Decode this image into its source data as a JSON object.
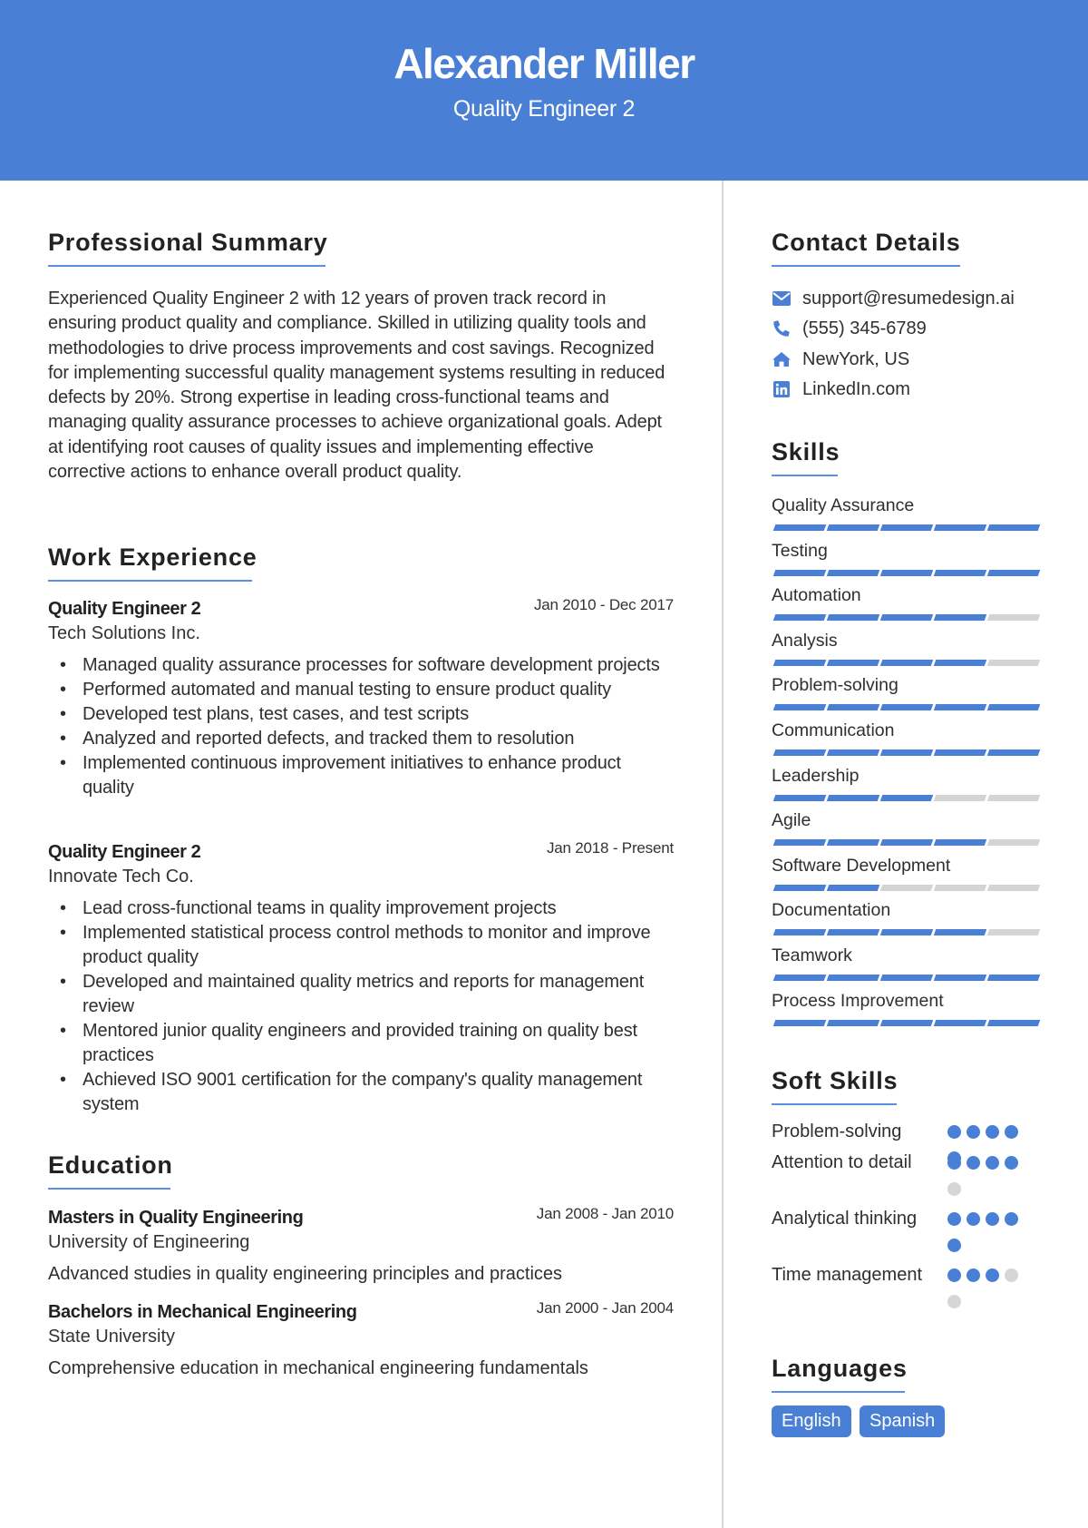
{
  "header": {
    "name": "Alexander Miller",
    "role": "Quality Engineer 2"
  },
  "colors": {
    "accent": "#4a7fd6",
    "track": "#d4d4d4",
    "divider": "#d6d6d6"
  },
  "summary": {
    "title": "Professional Summary",
    "text": "Experienced Quality Engineer 2 with 12 years of proven track record in ensuring product quality and compliance. Skilled in utilizing quality tools and methodologies to drive process improvements and cost savings. Recognized for implementing successful quality management systems resulting in reduced defects by 20%. Strong expertise in leading cross-functional teams and managing quality assurance processes to achieve organizational goals. Adept at identifying root causes of quality issues and implementing effective corrective actions to enhance overall product quality."
  },
  "experience": {
    "title": "Work Experience",
    "jobs": [
      {
        "title": "Quality Engineer 2",
        "dates": "Jan 2010 - Dec 2017",
        "company": "Tech Solutions Inc.",
        "bullets": [
          "Managed quality assurance processes for software development projects",
          "Performed automated and manual testing to ensure product quality",
          "Developed test plans, test cases, and test scripts",
          "Analyzed and reported defects, and tracked them to resolution",
          "Implemented continuous improvement initiatives to enhance product quality"
        ]
      },
      {
        "title": "Quality Engineer 2",
        "dates": "Jan 2018 - Present",
        "company": "Innovate Tech Co.",
        "bullets": [
          "Lead cross-functional teams in quality improvement projects",
          "Implemented statistical process control methods to monitor and improve product quality",
          "Developed and maintained quality metrics and reports for management review",
          "Mentored junior quality engineers and provided training on quality best practices",
          "Achieved ISO 9001 certification for the company's quality management system"
        ]
      }
    ]
  },
  "education": {
    "title": "Education",
    "items": [
      {
        "degree": "Masters in Quality Engineering",
        "dates": "Jan 2008 - Jan 2010",
        "school": "University of Engineering",
        "description": "Advanced studies in quality engineering principles and practices"
      },
      {
        "degree": "Bachelors in Mechanical Engineering",
        "dates": "Jan 2000 - Jan 2004",
        "school": "State University",
        "description": "Comprehensive education in mechanical engineering fundamentals"
      }
    ]
  },
  "contact": {
    "title": "Contact Details",
    "items": [
      {
        "icon": "envelope-icon",
        "text": "support@resumedesign.ai"
      },
      {
        "icon": "phone-icon",
        "text": "(555) 345-6789"
      },
      {
        "icon": "home-icon",
        "text": "NewYork, US"
      },
      {
        "icon": "linkedin-icon",
        "text": "LinkedIn.com"
      }
    ]
  },
  "skills": {
    "title": "Skills",
    "max": 5,
    "items": [
      {
        "name": "Quality Assurance",
        "level": 5
      },
      {
        "name": "Testing",
        "level": 5
      },
      {
        "name": "Automation",
        "level": 4
      },
      {
        "name": "Analysis",
        "level": 4
      },
      {
        "name": "Problem-solving",
        "level": 5
      },
      {
        "name": "Communication",
        "level": 5
      },
      {
        "name": "Leadership",
        "level": 3
      },
      {
        "name": "Agile",
        "level": 4
      },
      {
        "name": "Software Development",
        "level": 2
      },
      {
        "name": "Documentation",
        "level": 4
      },
      {
        "name": "Teamwork",
        "level": 5
      },
      {
        "name": "Process Improvement",
        "level": 5
      }
    ]
  },
  "soft_skills": {
    "title": "Soft Skills",
    "max": 5,
    "items": [
      {
        "name": "Problem-solving",
        "level": 5
      },
      {
        "name": "Attention to detail",
        "level": 4
      },
      {
        "name": "Analytical thinking",
        "level": 5
      },
      {
        "name": "Time management",
        "level": 3
      }
    ]
  },
  "languages": {
    "title": "Languages",
    "items": [
      "English",
      "Spanish"
    ]
  }
}
